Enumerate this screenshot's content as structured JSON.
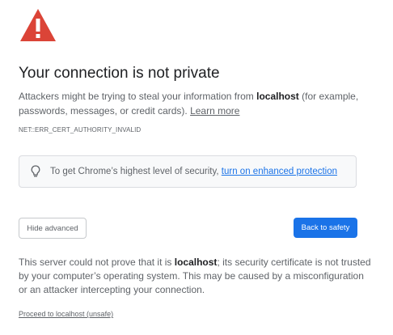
{
  "colors": {
    "warning_red": "#db4437",
    "primary_blue": "#1a73e8",
    "text_primary": "#202124",
    "text_secondary": "#5f6368"
  },
  "icons": {
    "warning": "warning-triangle-icon",
    "lightbulb": "lightbulb-icon"
  },
  "heading": "Your connection is not private",
  "explanation": {
    "prefix": "Attackers might be trying to steal your information from ",
    "host": "localhost",
    "suffix": " (for example, passwords, messages, or credit cards). ",
    "learn_more": "Learn more"
  },
  "error_code": "NET::ERR_CERT_AUTHORITY_INVALID",
  "enhanced_protection": {
    "prefix": "To get Chrome’s highest level of security, ",
    "link": "turn on enhanced protection"
  },
  "buttons": {
    "hide_advanced": "Hide advanced",
    "back_to_safety": "Back to safety"
  },
  "details": {
    "prefix": "This server could not prove that it is ",
    "host": "localhost",
    "suffix": "; its security certificate is not trusted by your computer’s operating system. This may be caused by a misconfiguration or an attacker intercepting your connection."
  },
  "proceed_link": "Proceed to localhost (unsafe)"
}
